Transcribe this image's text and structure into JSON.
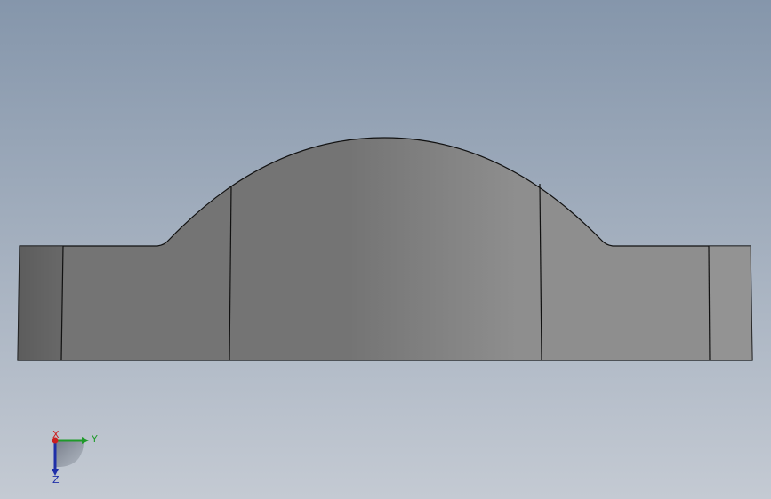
{
  "viewport": {
    "background_top_color": "#8596ab",
    "background_bottom_color": "#c4cad3"
  },
  "part": {
    "edge_color": "#111111",
    "shade_dark": "#5a5a5a",
    "shade_mid": "#747474",
    "shade_light": "#8e8e8e"
  },
  "triad": {
    "x_label": "X",
    "y_label": "Y",
    "z_label": "Z",
    "x_color": "#cc1f1f",
    "y_color": "#1f9a2a",
    "z_color": "#1f2fa8"
  }
}
